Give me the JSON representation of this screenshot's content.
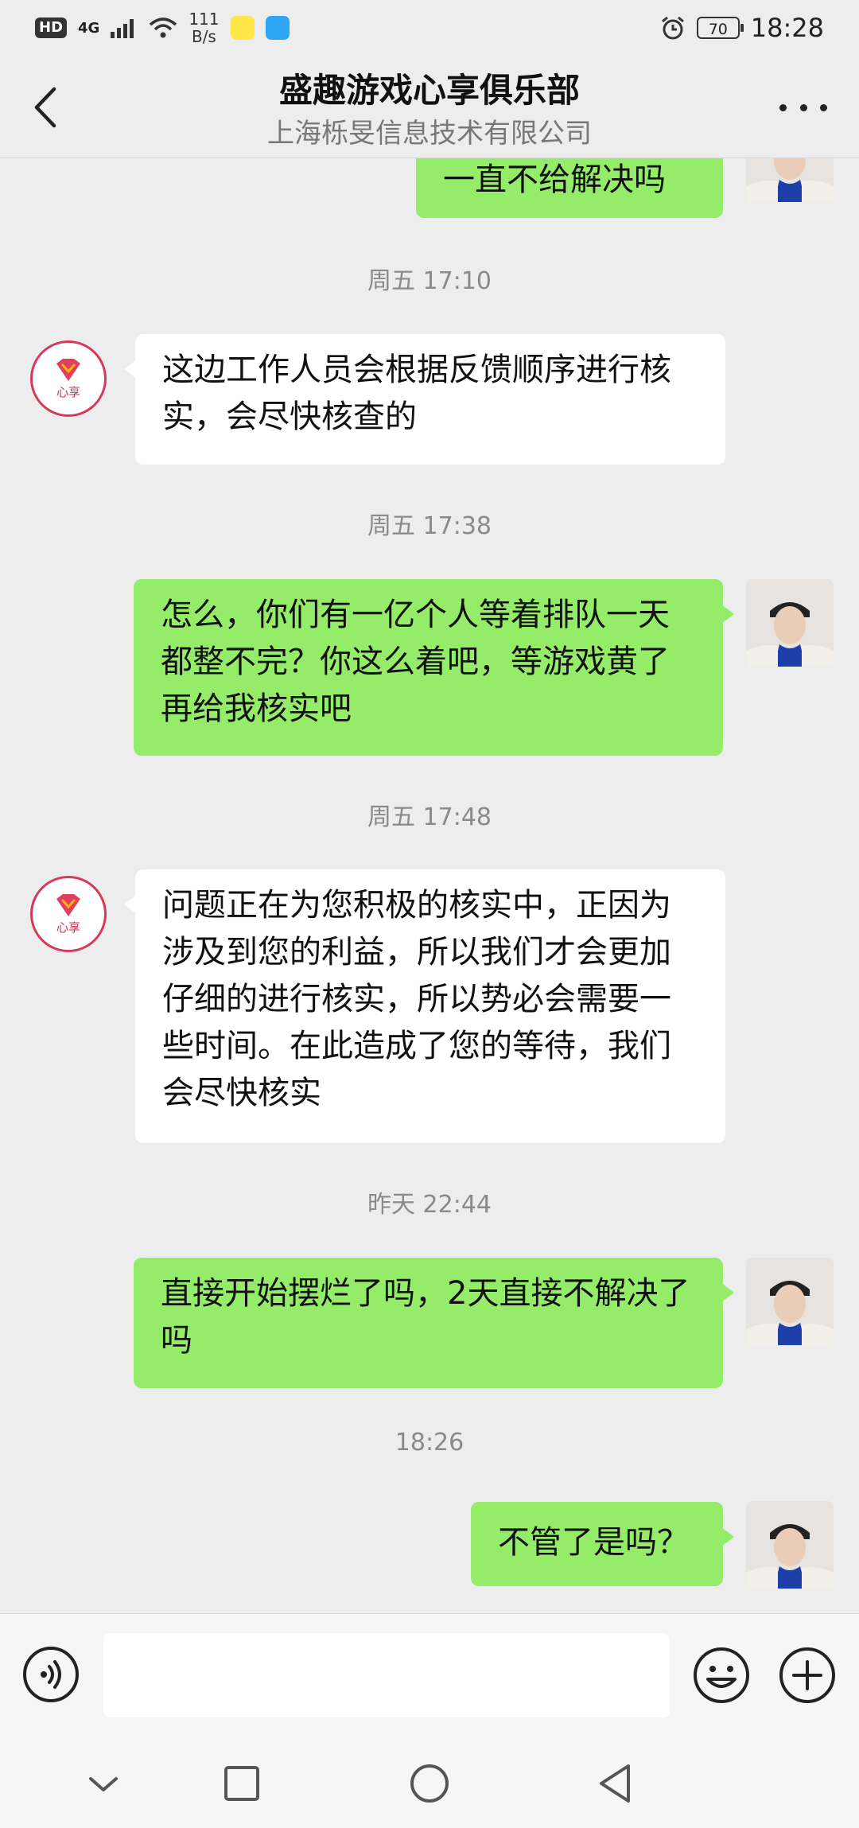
{
  "status_bar": {
    "hd": "HD",
    "network": "4G",
    "net_speed_value": "111",
    "net_speed_unit": "B/s",
    "battery": "70",
    "time": "18:28"
  },
  "header": {
    "title": "盛趣游戏心享俱乐部",
    "subtitle": "上海栎旻信息技术有限公司"
  },
  "shop_avatar_label": "心享",
  "messages": [
    {
      "type": "bubble",
      "side": "right",
      "text": "一直不给解决吗"
    },
    {
      "type": "time",
      "text": "周五 17:10"
    },
    {
      "type": "bubble",
      "side": "left",
      "text": "这边工作人员会根据反馈顺序进行核实，会尽快核查的"
    },
    {
      "type": "time",
      "text": "周五 17:38"
    },
    {
      "type": "bubble",
      "side": "right",
      "text": "怎么，你们有一亿个人等着排队一天都整不完？你这么着吧，等游戏黄了再给我核实吧"
    },
    {
      "type": "time",
      "text": "周五 17:48"
    },
    {
      "type": "bubble",
      "side": "left",
      "text": "问题正在为您积极的核实中，正因为涉及到您的利益，所以我们才会更加仔细的进行核实，所以势必会需要一些时间。在此造成了您的等待，我们会尽快核实"
    },
    {
      "type": "time",
      "text": "昨天 22:44"
    },
    {
      "type": "bubble",
      "side": "right",
      "text": "直接开始摆烂了吗，2天直接不解决了吗"
    },
    {
      "type": "time",
      "text": "18:26"
    },
    {
      "type": "bubble",
      "side": "right",
      "text": "不管了是吗？"
    }
  ],
  "input": {
    "value": "",
    "placeholder": ""
  },
  "icons": {
    "back": "chevron-left-icon",
    "more": "more-horizontal-icon",
    "voice": "voice-icon",
    "emoji": "emoji-icon",
    "plus": "plus-icon",
    "nav_down": "chevron-down-icon",
    "nav_recent": "square-icon",
    "nav_home": "circle-icon",
    "nav_back": "triangle-back-icon"
  },
  "colors": {
    "bubble_self": "#95ec69",
    "bubble_other": "#ffffff",
    "background": "#ededed",
    "brand": "#d63a5a"
  }
}
